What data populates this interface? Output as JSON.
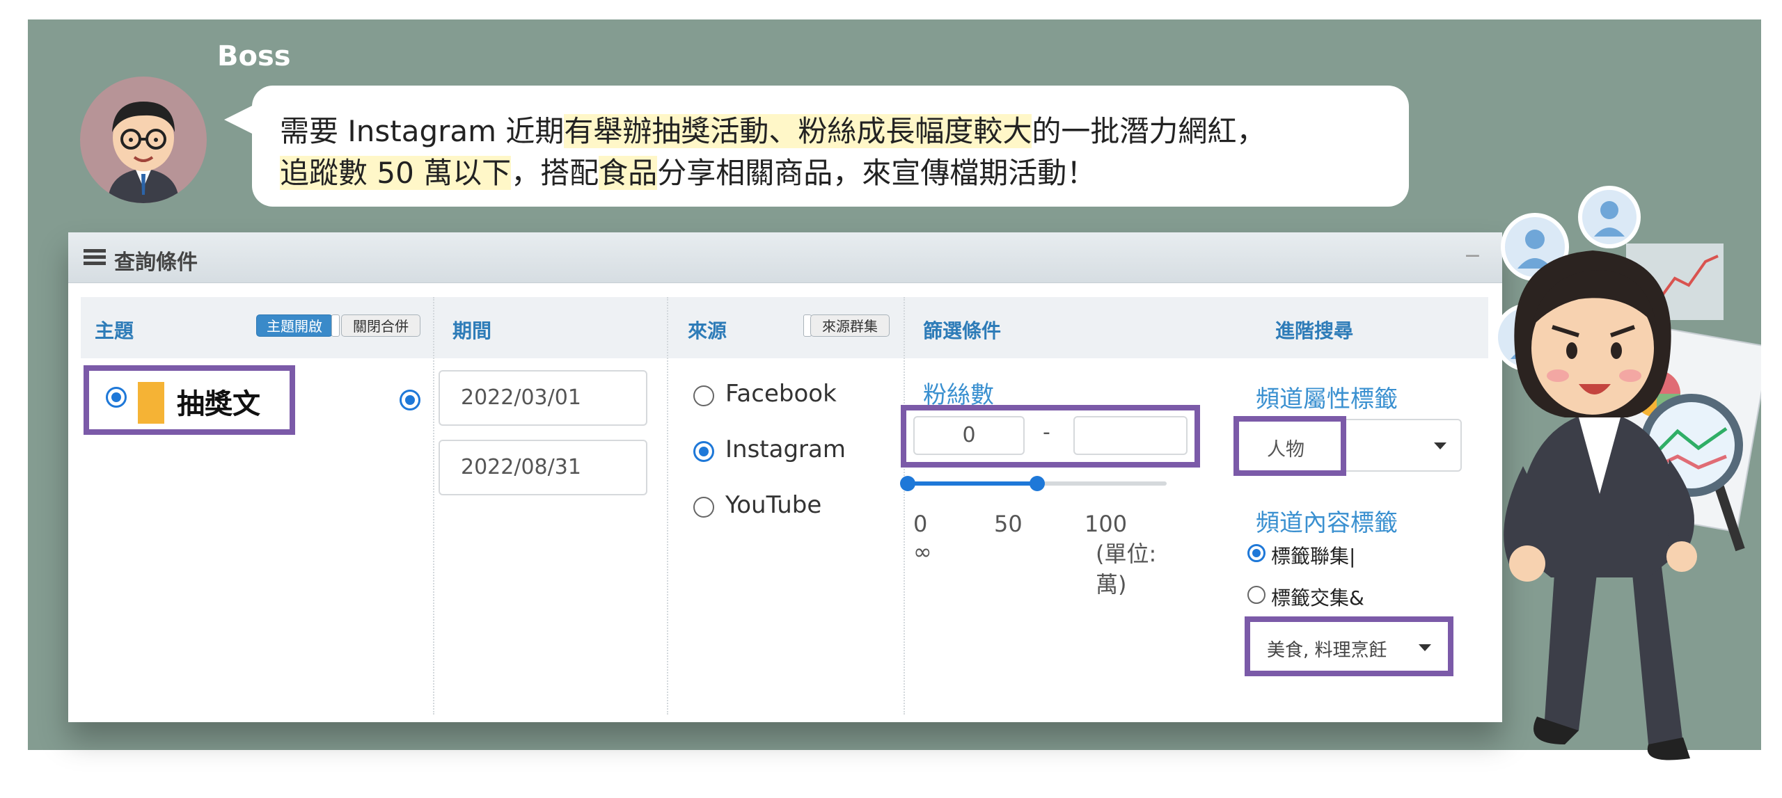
{
  "speaker": {
    "name": "Boss"
  },
  "message": {
    "line1": [
      {
        "text": "需要 Instagram 近期",
        "highlight": false
      },
      {
        "text": "有舉辦抽獎活動、粉絲成長幅度較大",
        "highlight": true
      },
      {
        "text": "的一批潛力網紅，",
        "highlight": false
      }
    ],
    "line2": [
      {
        "text": "追蹤數 50 萬以下",
        "highlight": true
      },
      {
        "text": "，搭配",
        "highlight": false
      },
      {
        "text": "食品",
        "highlight": true
      },
      {
        "text": "分享相關商品，來宣傳檔期活動！",
        "highlight": false
      }
    ]
  },
  "panel": {
    "title": "查詢條件",
    "collapse_symbol": "−",
    "columns": {
      "topic": "主題",
      "period": "期間",
      "source": "來源",
      "filter": "篩選條件",
      "advanced": "進階搜尋"
    },
    "topic": {
      "toggle_on": "主題開啟",
      "toggle_off": "關閉合併",
      "item": "抽獎文",
      "item_color": "#f5b335"
    },
    "period": {
      "start": "2022/03/01",
      "end": "2022/08/31"
    },
    "source": {
      "toggle": "來源群集",
      "options": [
        "Facebook",
        "Instagram",
        "YouTube"
      ],
      "selected": "Instagram"
    },
    "filter": {
      "label": "粉絲數",
      "min": "0",
      "separator": "-",
      "max": "",
      "range_low": 0,
      "range_high": 50,
      "ticks": [
        "0",
        "50",
        "100"
      ],
      "infinity": "∞",
      "unit": "(單位: 萬)"
    },
    "advanced": {
      "attr_label": "頻道屬性標籤",
      "attr_value": "人物",
      "content_label": "頻道內容標籤",
      "mode_options": [
        "標籤聯集|",
        "標籤交集&"
      ],
      "mode_selected": "標籤聯集|",
      "content_value": "美食, 料理烹飪"
    }
  },
  "colors": {
    "background": "#849c91",
    "highlight": "#fff7c8",
    "accent": "#2e7cb8",
    "callout": "#7b5aa8"
  },
  "icons": [
    "boss-avatar-icon",
    "list-icon",
    "caret-down-icon",
    "woman-illustration",
    "user-bubble-icon",
    "chart-report-icon",
    "magnifier-icon"
  ]
}
